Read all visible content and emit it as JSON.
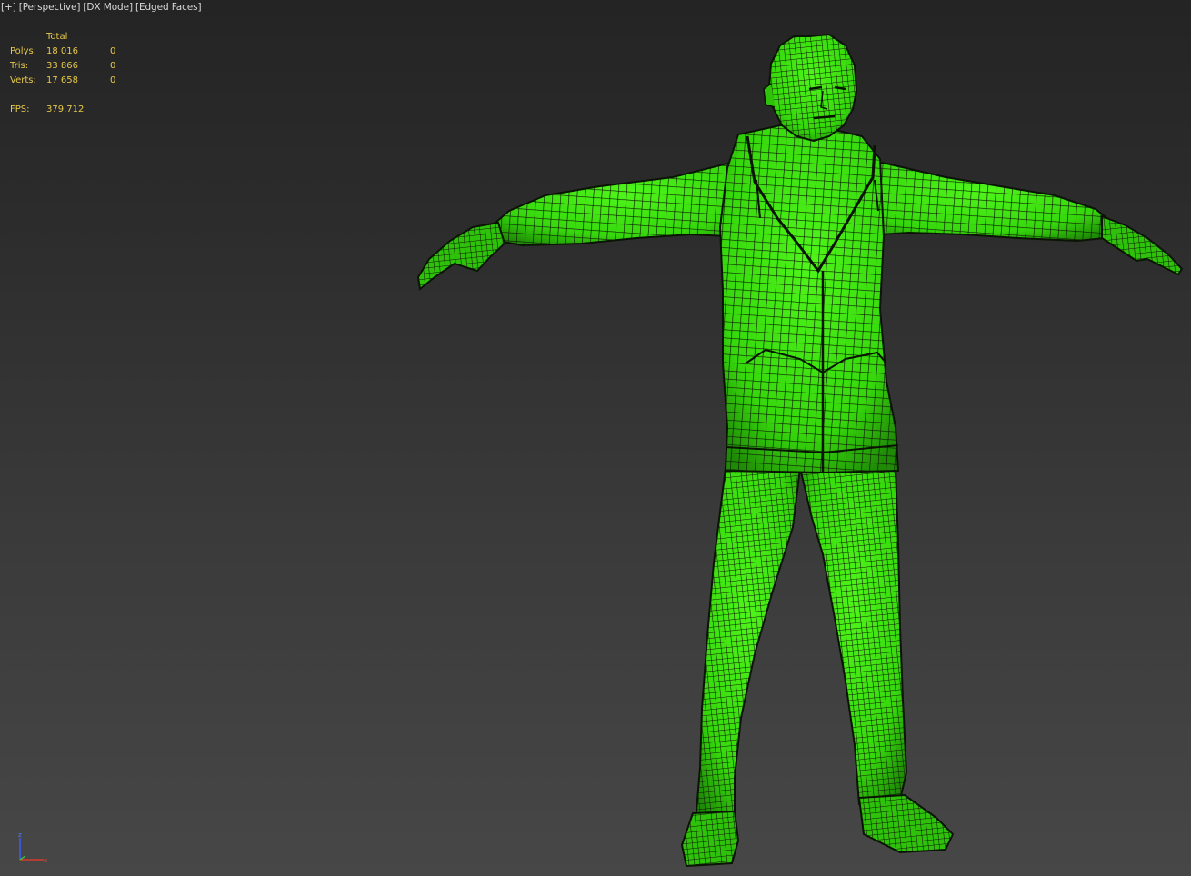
{
  "viewport": {
    "labels": [
      "[+]",
      "[Perspective]",
      "[DX Mode]",
      "[Edged Faces]"
    ]
  },
  "stats": {
    "header": "Total",
    "rows": [
      {
        "label": "Polys:",
        "total": "18 016",
        "selected": "0"
      },
      {
        "label": "Tris:",
        "total": "33 866",
        "selected": "0"
      },
      {
        "label": "Verts:",
        "total": "17 658",
        "selected": "0"
      }
    ],
    "fps_label": "FPS:",
    "fps_value": "379.712"
  },
  "gizmo": {
    "z_label": "z",
    "x_label": "x"
  },
  "colors": {
    "mesh_fill": "#3ee80e",
    "wire": "#0c1a06",
    "stats_text": "#e6c84a",
    "label_text": "#d8d8d8"
  }
}
